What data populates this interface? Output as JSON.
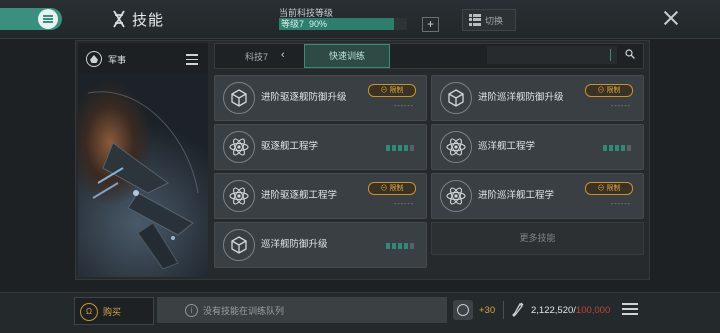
{
  "header": {
    "title": "技能",
    "level_label": "当前科技等级",
    "level_value": "等级7",
    "level_percent": "90%",
    "level_progress": 0.9,
    "plus_label": "+",
    "switch_label": "切换"
  },
  "sidebar": {
    "category": "军事"
  },
  "tabs": {
    "prev_label": "科技7",
    "active_label": "快速训练",
    "search_placeholder": ""
  },
  "cards": [
    {
      "name": "进阶驱逐舰防御升级",
      "icon": "cube-icon",
      "badge": "限制",
      "dash": "------"
    },
    {
      "name": "进阶巡洋舰防御升级",
      "icon": "cube-icon",
      "badge": "限制",
      "dash": "------"
    },
    {
      "name": "驱逐舰工程学",
      "icon": "atom-icon",
      "progress_pips": 4,
      "pips_total": 5
    },
    {
      "name": "巡洋舰工程学",
      "icon": "atom-icon",
      "progress_pips": 4,
      "pips_total": 5
    },
    {
      "name": "进阶驱逐舰工程学",
      "icon": "atom-icon",
      "badge": "限制",
      "dash": "------"
    },
    {
      "name": "进阶巡洋舰工程学",
      "icon": "atom-icon",
      "badge": "限制",
      "dash": "------"
    },
    {
      "name": "巡洋舰防御升级",
      "icon": "cube-icon",
      "progress_pips": 4,
      "pips_total": 5
    }
  ],
  "more_label": "更多技能",
  "footer": {
    "buy_label": "购买",
    "buy_icon_text": "",
    "queue_text": "没有技能在训练队列",
    "bonus_value": "+30",
    "sp_current": "2,122,520",
    "sp_max": "100,000"
  },
  "colors": {
    "accent": "#3a8f7f",
    "gold": "#d8a545",
    "warning": "#c0453a"
  }
}
